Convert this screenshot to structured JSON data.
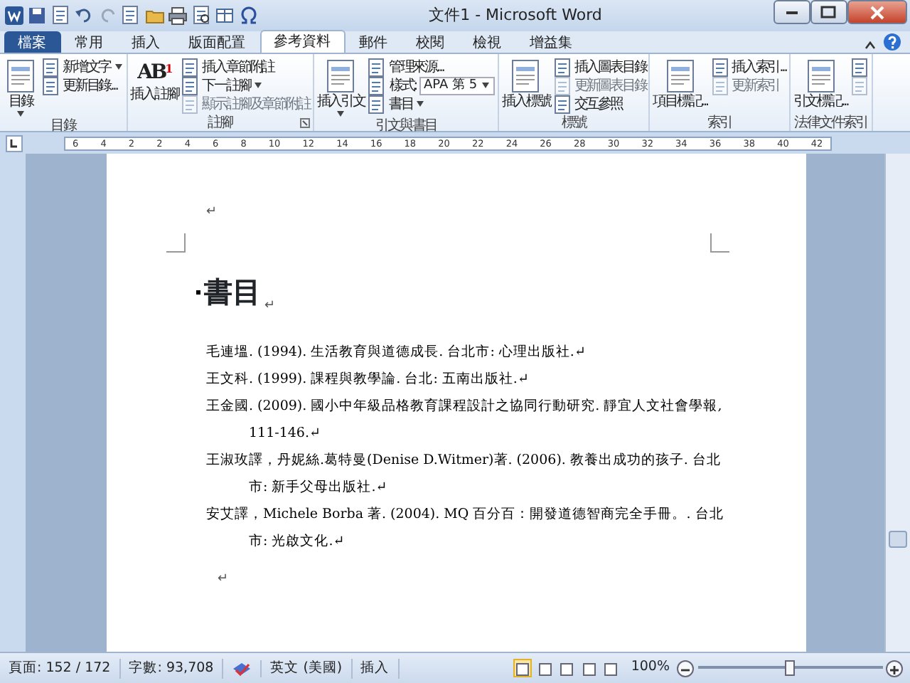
{
  "window": {
    "title": "文件1 - Microsoft Word"
  },
  "tabs": [
    {
      "label": "檔案",
      "kind": "file",
      "selected": false
    },
    {
      "label": "常用",
      "kind": "tab",
      "selected": false
    },
    {
      "label": "插入",
      "kind": "tab",
      "selected": false
    },
    {
      "label": "版面配置",
      "kind": "tab",
      "selected": false
    },
    {
      "label": "參考資料",
      "kind": "tab",
      "selected": true
    },
    {
      "label": "郵件",
      "kind": "tab",
      "selected": false
    },
    {
      "label": "校閱",
      "kind": "tab",
      "selected": false
    },
    {
      "label": "檢視",
      "kind": "tab",
      "selected": false
    },
    {
      "label": "增益集",
      "kind": "tab",
      "selected": false
    }
  ],
  "ribbon_groups": [
    {
      "label": "目錄",
      "launcher": false,
      "items": [
        {
          "kind": "large",
          "label": "目錄",
          "dropdown": true,
          "disabled": false
        },
        {
          "kind": "small",
          "label": "新增文字",
          "dropdown": true,
          "disabled": false
        },
        {
          "kind": "small",
          "label": "更新目錄...",
          "dropdown": false,
          "disabled": false
        }
      ]
    },
    {
      "label": "註腳",
      "launcher": true,
      "items": [
        {
          "kind": "large",
          "label": "插入註腳",
          "glyph": "AB$^{1}$",
          "dropdown": false,
          "disabled": false
        },
        {
          "kind": "small",
          "label": "插入章節附註",
          "dropdown": false,
          "disabled": false
        },
        {
          "kind": "small",
          "label": "下一註腳",
          "dropdown": true,
          "disabled": false
        },
        {
          "kind": "small",
          "label": "顯示註腳及章節附註",
          "dropdown": false,
          "disabled": true
        }
      ]
    },
    {
      "label": "引文與書目",
      "launcher": false,
      "items": [
        {
          "kind": "large",
          "label": "插入引文",
          "dropdown": true,
          "disabled": false
        },
        {
          "kind": "small",
          "label": "管理來源...",
          "dropdown": false,
          "disabled": false
        },
        {
          "kind": "select",
          "label": "樣式:",
          "value": "APA 第 5",
          "disabled": false
        },
        {
          "kind": "small",
          "label": "書目",
          "dropdown": true,
          "disabled": false
        }
      ]
    },
    {
      "label": "標號",
      "launcher": false,
      "items": [
        {
          "kind": "large",
          "label": "插入標號",
          "dropdown": false,
          "disabled": false
        },
        {
          "kind": "small",
          "label": "插入圖表目錄",
          "dropdown": false,
          "disabled": false
        },
        {
          "kind": "small",
          "label": "更新圖表目錄",
          "dropdown": false,
          "disabled": true
        },
        {
          "kind": "small",
          "label": "交互參照",
          "dropdown": false,
          "disabled": false
        }
      ]
    },
    {
      "label": "索引",
      "launcher": false,
      "items": [
        {
          "kind": "large",
          "label": "項目標記...",
          "dropdown": false,
          "disabled": false
        },
        {
          "kind": "small",
          "label": "插入索引...",
          "dropdown": false,
          "disabled": false
        },
        {
          "kind": "small",
          "label": "更新索引",
          "dropdown": false,
          "disabled": true
        }
      ]
    },
    {
      "label": "法律文件索引",
      "launcher": false,
      "items": [
        {
          "kind": "large",
          "label": "引文標記...",
          "dropdown": false,
          "disabled": false
        },
        {
          "kind": "iconsmall",
          "disabled": false
        },
        {
          "kind": "iconsmall",
          "disabled": true
        }
      ]
    }
  ],
  "ruler": [
    "6",
    "4",
    "2",
    "2",
    "4",
    "6",
    "8",
    "10",
    "12",
    "14",
    "16",
    "18",
    "20",
    "22",
    "24",
    "26",
    "28",
    "30",
    "32",
    "34",
    "36",
    "38",
    "40",
    "42"
  ],
  "document": {
    "top_mark": "↵",
    "heading": "書目",
    "heading_mark": "↵",
    "entries": [
      {
        "text": "毛連塭. (1994). 生活教育與道德成長. 台北市: 心理出版社.↵"
      },
      {
        "text": "王文科. (1999). 課程與教學論. 台北: 五南出版社.↵"
      },
      {
        "text": "王金國. (2009). 國小中年級品格教育課程設計之協同行動研究. 靜宜人文社會學報, 111-146.↵"
      },
      {
        "text": "王淑玫譯，丹妮絲.葛特曼(Denise D.Witmer)著. (2006). 教養出成功的孩子. 台北市: 新手父母出版社.↵"
      },
      {
        "text": "安艾譯，Michele Borba 著. (2004). MQ 百分百：開發道德智商完全手冊。. 台北市: 光啟文化.↵"
      }
    ],
    "end_mark": "↵"
  },
  "status_bar": {
    "page": "頁面: 152 / 172",
    "words": "字數: 93,708",
    "language": "英文 (美國)",
    "mode": "插入",
    "zoom": "100%",
    "zoom_slider": {
      "level": 0.5
    },
    "views": [
      {
        "selected": true
      },
      {
        "selected": false
      },
      {
        "selected": false
      },
      {
        "selected": false
      },
      {
        "selected": false
      }
    ]
  }
}
